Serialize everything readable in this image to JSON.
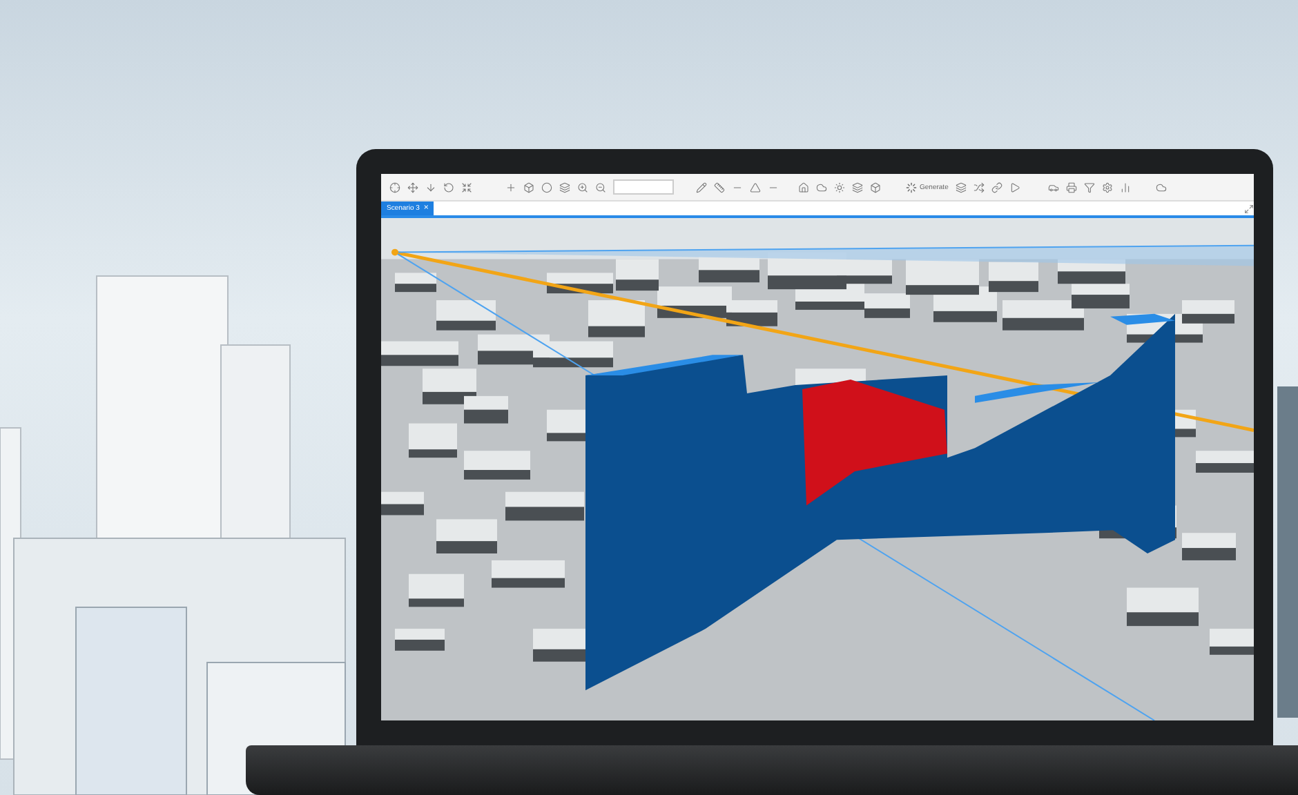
{
  "toolbar": {
    "generate": "Generate"
  },
  "tabs": [
    {
      "label": "Scenario 3",
      "selected": true,
      "close": "×"
    }
  ]
}
